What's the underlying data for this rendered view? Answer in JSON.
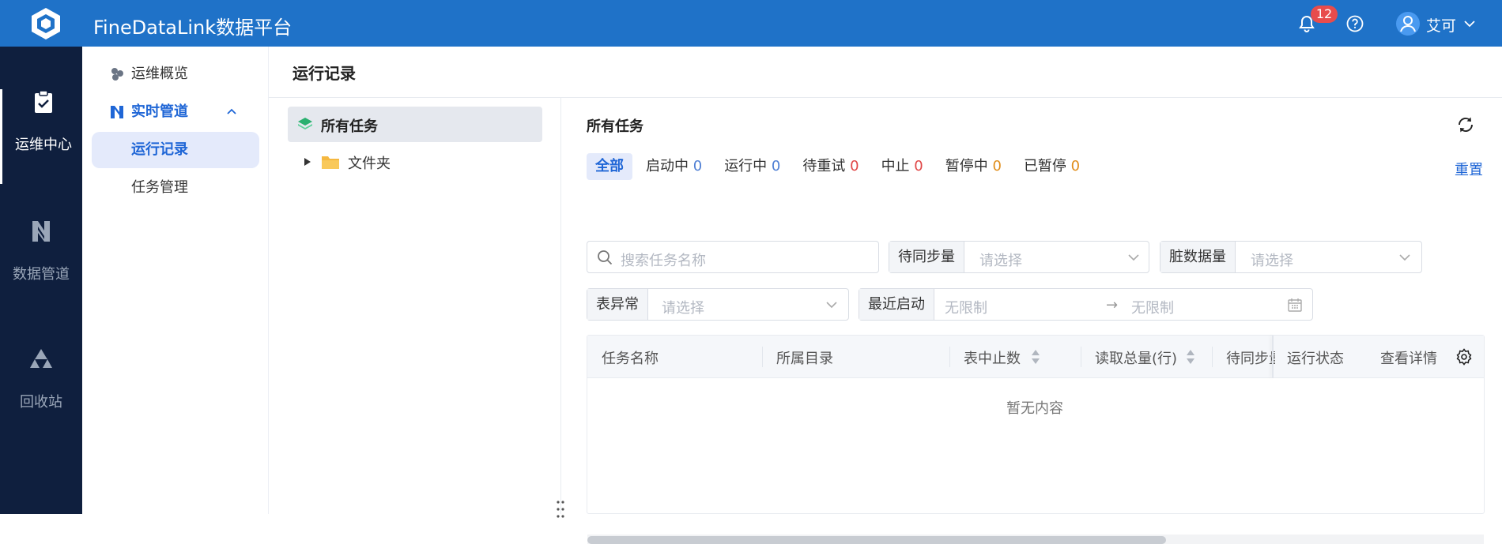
{
  "app": {
    "title": "FineDataLink数据平台"
  },
  "header": {
    "notification_count": "12",
    "username": "艾可"
  },
  "left_nav": [
    {
      "label": "运维中心"
    },
    {
      "label": "数据管道"
    },
    {
      "label": "回收站"
    }
  ],
  "sub_nav": {
    "overview": "运维概览",
    "realtime": "实时管道",
    "run_records": "运行记录",
    "task_mgmt": "任务管理"
  },
  "page": {
    "title": "运行记录"
  },
  "tree": {
    "all": "所有任务",
    "folder": "文件夹"
  },
  "tasks": {
    "title": "所有任务",
    "reset": "重置",
    "filters": [
      {
        "label": "全部",
        "count": ""
      },
      {
        "label": "启动中",
        "count": "0"
      },
      {
        "label": "运行中",
        "count": "0"
      },
      {
        "label": "待重试",
        "count": "0"
      },
      {
        "label": "中止",
        "count": "0"
      },
      {
        "label": "暂停中",
        "count": "0"
      },
      {
        "label": "已暂停",
        "count": "0"
      }
    ],
    "search_placeholder": "搜索任务名称",
    "pending_label": "待同步量",
    "dirty_label": "脏数据量",
    "exception_label": "表异常",
    "recent_label": "最近启动",
    "select_placeholder": "请选择",
    "unlimited": "无限制",
    "range_arrow": "→",
    "columns": [
      "任务名称",
      "所属目录",
      "表中止数",
      "读取总量(行)",
      "待同步量",
      "运行状态",
      "查看详情"
    ],
    "empty": "暂无内容"
  },
  "colors": {
    "header_bg": "#1f72c8",
    "nav_bg": "#0f1f3e",
    "accent": "#1f66d6",
    "badge": "#e84c4c"
  }
}
